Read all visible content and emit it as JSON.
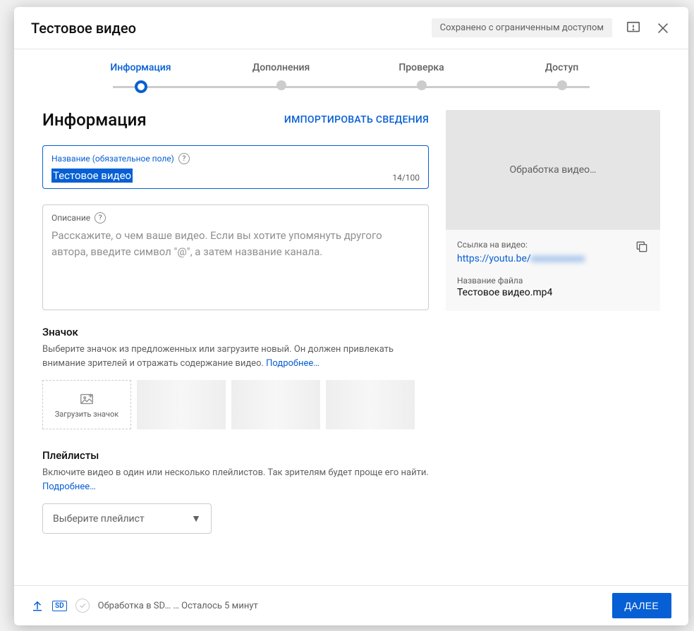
{
  "header": {
    "title": "Тестовое видео",
    "save_status": "Сохранено с ограниченным доступом"
  },
  "stepper": {
    "steps": [
      "Информация",
      "Дополнения",
      "Проверка",
      "Доступ"
    ],
    "active_index": 0
  },
  "info": {
    "section_title": "Информация",
    "import_label": "ИМПОРТИРОВАТЬ СВЕДЕНИЯ",
    "title_field": {
      "label": "Название (обязательное поле)",
      "value": "Тестовое видео",
      "counter": "14/100"
    },
    "desc_field": {
      "label": "Описание",
      "placeholder": "Расскажите, о чем ваше видео. Если вы хотите упомянуть другого автора, введите символ \"@\", а затем название канала."
    },
    "thumbnail": {
      "heading": "Значок",
      "description": "Выберите значок из предложенных или загрузите новый. Он должен привлекать внимание зрителей и отражать содержание видео. ",
      "more": "Подробнее…",
      "upload_label": "Загрузить значок"
    },
    "playlists": {
      "heading": "Плейлисты",
      "description": "Включите видео в один или несколько плейлистов. Так зрителям будет проще его найти. ",
      "more": "Подробнее…",
      "select_placeholder": "Выберите плейлист"
    }
  },
  "preview": {
    "processing": "Обработка видео…",
    "link_label": "Ссылка на видео:",
    "link_prefix": "https://youtu.be/",
    "link_id_hidden": "xxxxxxxxxxx",
    "file_label": "Название файла",
    "file_name": "Тестовое видео.mp4"
  },
  "footer": {
    "sd_badge": "SD",
    "status_text": "Обработка в SD… … Осталось 5 минут",
    "next_label": "ДАЛЕЕ"
  }
}
